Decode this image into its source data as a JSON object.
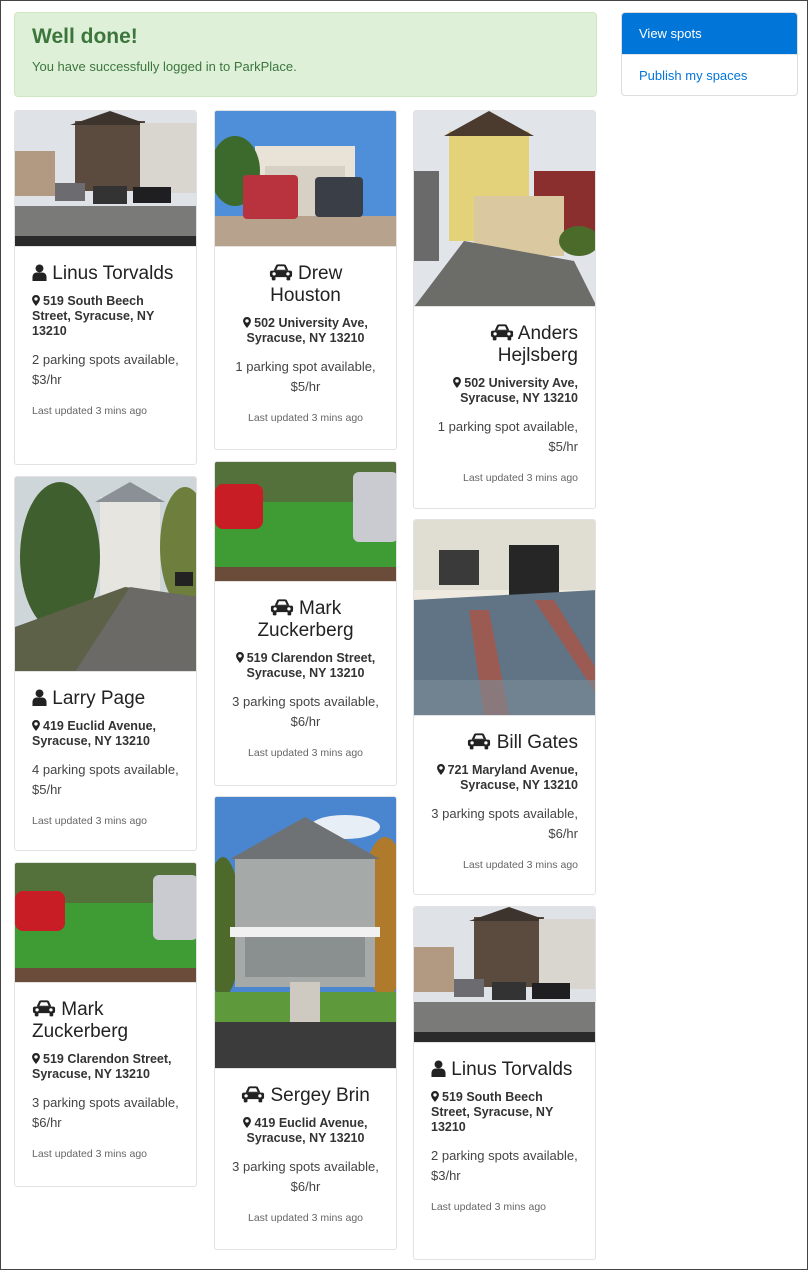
{
  "alert": {
    "title": "Well done!",
    "message": "You have successfully logged in to ParkPlace."
  },
  "nav": {
    "items": [
      {
        "label": "View spots",
        "active": true
      },
      {
        "label": "Publish my spaces",
        "active": false
      }
    ]
  },
  "listings": [
    {
      "owner": "Linus Torvalds",
      "icon": "user-icon",
      "address": "519 South Beech Street, Syracuse, NY 13210",
      "availability": "2 parking spots available, $3/hr",
      "updated": "Last updated 3 mins ago",
      "align": "left"
    },
    {
      "owner": "Drew Houston",
      "icon": "car-icon",
      "address": "502 University Ave, Syracuse, NY 13210",
      "availability": "1 parking spot available, $5/hr",
      "updated": "Last updated 3 mins ago",
      "align": "center"
    },
    {
      "owner": "Anders Hejlsberg",
      "icon": "car-icon",
      "address": "502 University Ave, Syracuse, NY 13210",
      "availability": "1 parking spot available, $5/hr",
      "updated": "Last updated 3 mins ago",
      "align": "right"
    },
    {
      "owner": "Larry Page",
      "icon": "user-icon",
      "address": "419 Euclid Avenue, Syracuse, NY 13210",
      "availability": "4 parking spots available, $5/hr",
      "updated": "Last updated 3 mins ago",
      "align": "left"
    },
    {
      "owner": "Mark Zuckerberg",
      "icon": "car-icon",
      "address": "519 Clarendon Street, Syracuse, NY 13210",
      "availability": "3 parking spots available, $6/hr",
      "updated": "Last updated 3 mins ago",
      "align": "center"
    },
    {
      "owner": "Bill Gates",
      "icon": "car-icon",
      "address": "721 Maryland Avenue, Syracuse, NY 13210",
      "availability": "3 parking spots available, $6/hr",
      "updated": "Last updated 3 mins ago",
      "align": "right"
    },
    {
      "owner": "Mark Zuckerberg",
      "icon": "car-icon",
      "address": "519 Clarendon Street, Syracuse, NY 13210",
      "availability": "3 parking spots available, $6/hr",
      "updated": "Last updated 3 mins ago",
      "align": "left"
    },
    {
      "owner": "Sergey Brin",
      "icon": "car-icon",
      "address": "419 Euclid Avenue, Syracuse, NY 13210",
      "availability": "3 parking spots available, $6/hr",
      "updated": "Last updated 3 mins ago",
      "align": "center"
    },
    {
      "owner": "Linus Torvalds",
      "icon": "user-icon",
      "address": "519 South Beech Street, Syracuse, NY 13210",
      "availability": "2 parking spots available, $3/hr",
      "updated": "Last updated 3 mins ago",
      "align": "left"
    }
  ],
  "colors": {
    "success_bg": "#dff0d8",
    "success_text": "#3c763d",
    "primary": "#0275d8"
  }
}
